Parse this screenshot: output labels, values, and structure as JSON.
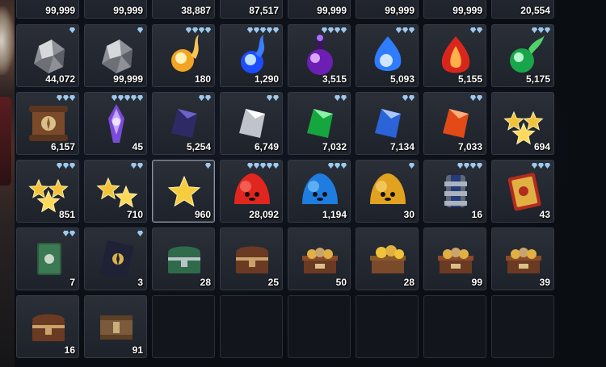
{
  "inventory": {
    "row0": [
      {
        "name": "item-0-0",
        "qty": "99,999"
      },
      {
        "name": "item-0-1",
        "qty": "99,999"
      },
      {
        "name": "item-0-2",
        "qty": "38,887"
      },
      {
        "name": "item-0-3",
        "qty": "87,517"
      },
      {
        "name": "item-0-4",
        "qty": "99,999"
      },
      {
        "name": "item-0-5",
        "qty": "99,999"
      },
      {
        "name": "item-0-6",
        "qty": "99,999"
      },
      {
        "name": "item-0-7",
        "qty": "20,554"
      }
    ],
    "row1": [
      {
        "icon": "gray-ore-icon",
        "qty": "44,072",
        "grade": 1
      },
      {
        "icon": "gray-ore-icon",
        "qty": "99,999",
        "grade": 1
      },
      {
        "icon": "gold-flame-orb-icon",
        "qty": "180",
        "grade": 4
      },
      {
        "icon": "blue-flame-orb-icon",
        "qty": "1,290",
        "grade": 5
      },
      {
        "icon": "purple-potion-orb-icon",
        "qty": "3,515",
        "grade": 4
      },
      {
        "icon": "blue-essence-orb-icon",
        "qty": "5,093",
        "grade": 3
      },
      {
        "icon": "red-fire-crystal-icon",
        "qty": "5,155",
        "grade": 2
      },
      {
        "icon": "green-leaf-orb-icon",
        "qty": "5,175",
        "grade": 3
      }
    ],
    "row2": [
      {
        "icon": "scroll-icon",
        "qty": "6,157",
        "grade": 3
      },
      {
        "icon": "purple-crest-icon",
        "qty": "45",
        "grade": 5
      },
      {
        "icon": "dark-purple-crystal-icon",
        "qty": "5,254",
        "grade": 2
      },
      {
        "icon": "white-crystal-icon",
        "qty": "6,749",
        "grade": 2
      },
      {
        "icon": "green-crystal-icon",
        "qty": "7,032",
        "grade": 2
      },
      {
        "icon": "blue-crystal-icon",
        "qty": "7,134",
        "grade": 2
      },
      {
        "icon": "orange-crystal-icon",
        "qty": "7,033",
        "grade": 2
      },
      {
        "icon": "triple-star-icon",
        "qty": "694",
        "grade": 0
      }
    ],
    "row3": [
      {
        "icon": "triple-star-icon",
        "qty": "851",
        "grade": 3
      },
      {
        "icon": "double-star-icon",
        "qty": "710",
        "grade": 2
      },
      {
        "icon": "single-star-icon",
        "qty": "960",
        "grade": 1
      },
      {
        "icon": "red-slime-icon",
        "qty": "28,092",
        "grade": 5
      },
      {
        "icon": "blue-slime-icon",
        "qty": "1,194",
        "grade": 3
      },
      {
        "icon": "gold-slime-icon",
        "qty": "30",
        "grade": 1
      },
      {
        "icon": "armor-gauntlet-icon",
        "qty": "16",
        "grade": 4
      },
      {
        "icon": "red-spellbook-icon",
        "qty": "43",
        "grade": 3
      }
    ],
    "row4": [
      {
        "icon": "green-book-icon",
        "qty": "7",
        "grade": 2
      },
      {
        "icon": "dark-crest-book-icon",
        "qty": "3",
        "grade": 1
      },
      {
        "icon": "green-chest-icon",
        "qty": "28",
        "grade": 0
      },
      {
        "icon": "brown-chest-icon",
        "qty": "25",
        "grade": 0
      },
      {
        "icon": "treasure-pile-chest-icon",
        "qty": "50",
        "grade": 0
      },
      {
        "icon": "gold-treasure-chest-icon",
        "qty": "28",
        "grade": 0
      },
      {
        "icon": "treasure-pile-chest-icon",
        "qty": "99",
        "grade": 0
      },
      {
        "icon": "treasure-pile-chest-icon",
        "qty": "39",
        "grade": 0
      }
    ],
    "row5": [
      {
        "icon": "brown-chest-icon",
        "qty": "16",
        "grade": 0
      },
      {
        "icon": "wooden-crate-icon",
        "qty": "91",
        "grade": 0
      },
      {
        "empty": true
      },
      {
        "empty": true
      },
      {
        "empty": true
      },
      {
        "empty": true
      },
      {
        "empty": true
      },
      {
        "empty": true
      }
    ]
  },
  "colors": {
    "grade_gem": "#9ec9ee",
    "slot_bg": "#262b34",
    "slot_border": "#343a45",
    "empty_bg": "#12161c"
  }
}
